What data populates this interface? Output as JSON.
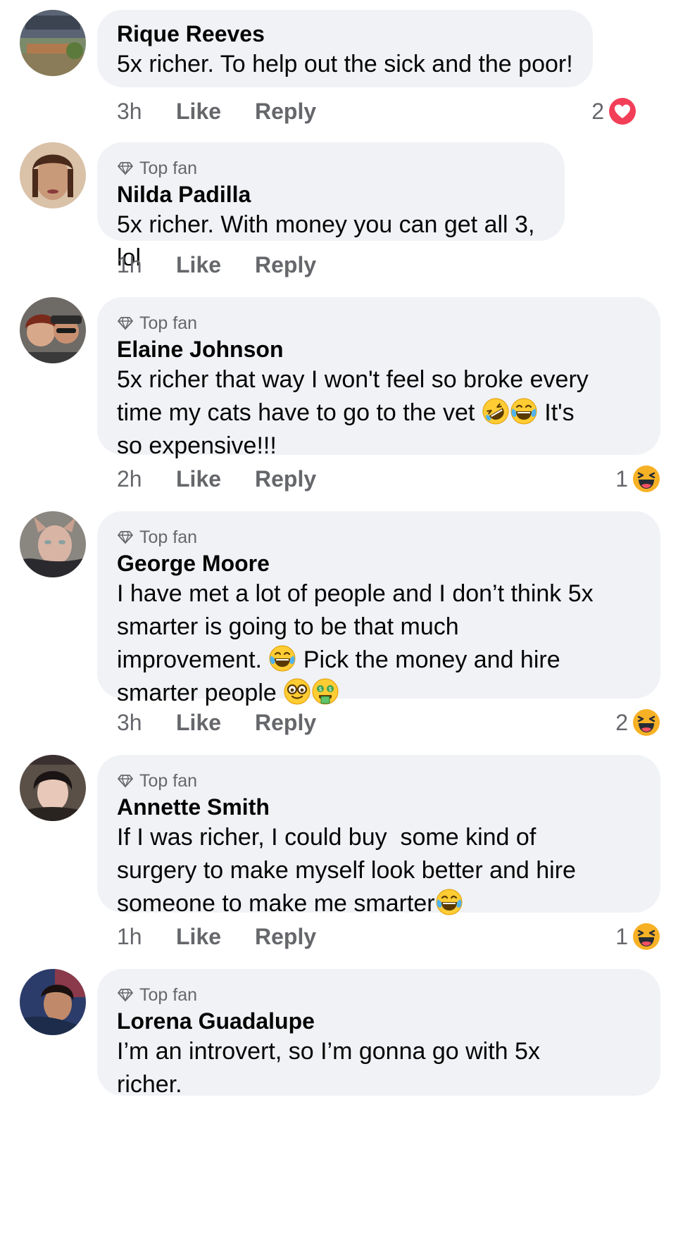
{
  "labels": {
    "like": "Like",
    "reply": "Reply",
    "top_fan": "Top fan"
  },
  "comments": [
    {
      "author": "Rique Reeves",
      "top_fan": false,
      "text": [
        "5x richer. To help out the sick and the poor!"
      ],
      "time": "3h",
      "reaction_count": "2",
      "reaction_icon": "love-icon"
    },
    {
      "author": "Nilda Padilla",
      "top_fan": true,
      "text": [
        "5x richer. With money you can get all 3, lol"
      ],
      "time": "1h",
      "reaction_count": "",
      "reaction_icon": ""
    },
    {
      "author": "Elaine Johnson",
      "top_fan": true,
      "text": [
        "5x richer that way I won't feel so broke every",
        "time my cats have to go to the vet",
        "It's",
        "so expensive!!!"
      ],
      "time": "2h",
      "reaction_count": "1",
      "reaction_icon": "haha-icon"
    },
    {
      "author": "George Moore",
      "top_fan": true,
      "text": [
        "I have met a lot of people and I don’t think 5x",
        "smarter is going to be that much",
        "improvement.",
        "Pick the money and hire",
        "smarter people"
      ],
      "time": "3h",
      "reaction_count": "2",
      "reaction_icon": "haha-icon"
    },
    {
      "author": "Annette Smith",
      "top_fan": true,
      "text": [
        "If I was richer, I could buy  some kind of",
        "surgery to make myself look better and hire",
        "someone to make me smarter"
      ],
      "time": "1h",
      "reaction_count": "1",
      "reaction_icon": "haha-icon"
    },
    {
      "author": "Lorena Guadalupe",
      "top_fan": true,
      "text": [
        "I’m an introvert, so I’m gonna go with 5x",
        "richer."
      ],
      "time": "",
      "reaction_count": "",
      "reaction_icon": ""
    }
  ],
  "colors": {
    "bubble": "#f0f2f5",
    "meta_text": "#65676b",
    "love": "#f33e58",
    "haha": "#f7b125"
  }
}
